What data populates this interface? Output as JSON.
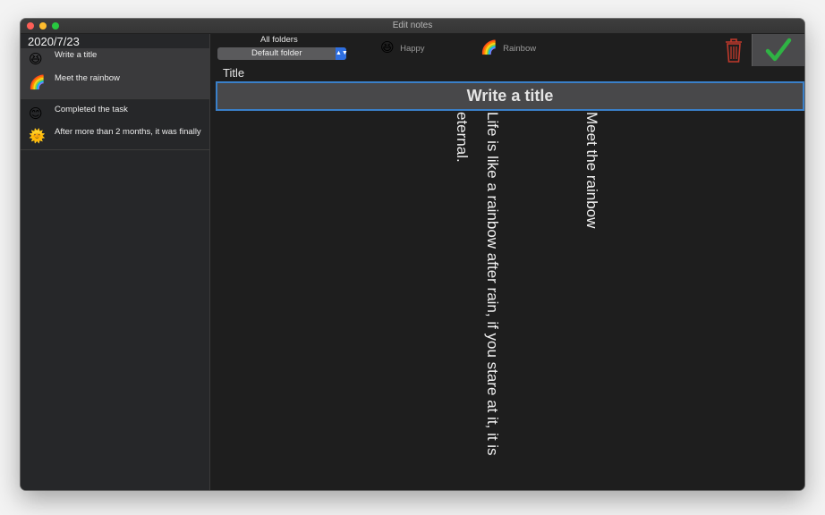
{
  "window": {
    "title": "Edit notes"
  },
  "sidebar": {
    "date": "2020/7/23",
    "groups": [
      {
        "items": [
          {
            "emoji": "😆",
            "label": "Write a title"
          },
          {
            "emoji": "🌈",
            "label": "Meet the rainbow"
          }
        ]
      },
      {
        "items": [
          {
            "emoji": "😊",
            "label": "Completed the task"
          },
          {
            "emoji": "🌞",
            "label": "After more than 2 months, it was finally"
          }
        ]
      }
    ]
  },
  "toolbar": {
    "folders_label": "All folders",
    "folder_selected": "Default folder",
    "tags": [
      {
        "emoji": "😆",
        "label": "Happy"
      },
      {
        "emoji": "🌈",
        "label": "Rainbow"
      }
    ],
    "trash_color": "#c0392b",
    "confirm_color": "#2fb344"
  },
  "editor": {
    "title_label": "Title",
    "title_placeholder": "Write a title",
    "title_value": "",
    "heading_line": "Meet the rainbow",
    "body_text": "Life is like a rainbow after rain, if you stare at it, it is eternal."
  },
  "colors": {
    "accent": "#3a80c9",
    "select_blue": "#2f6fe0"
  }
}
